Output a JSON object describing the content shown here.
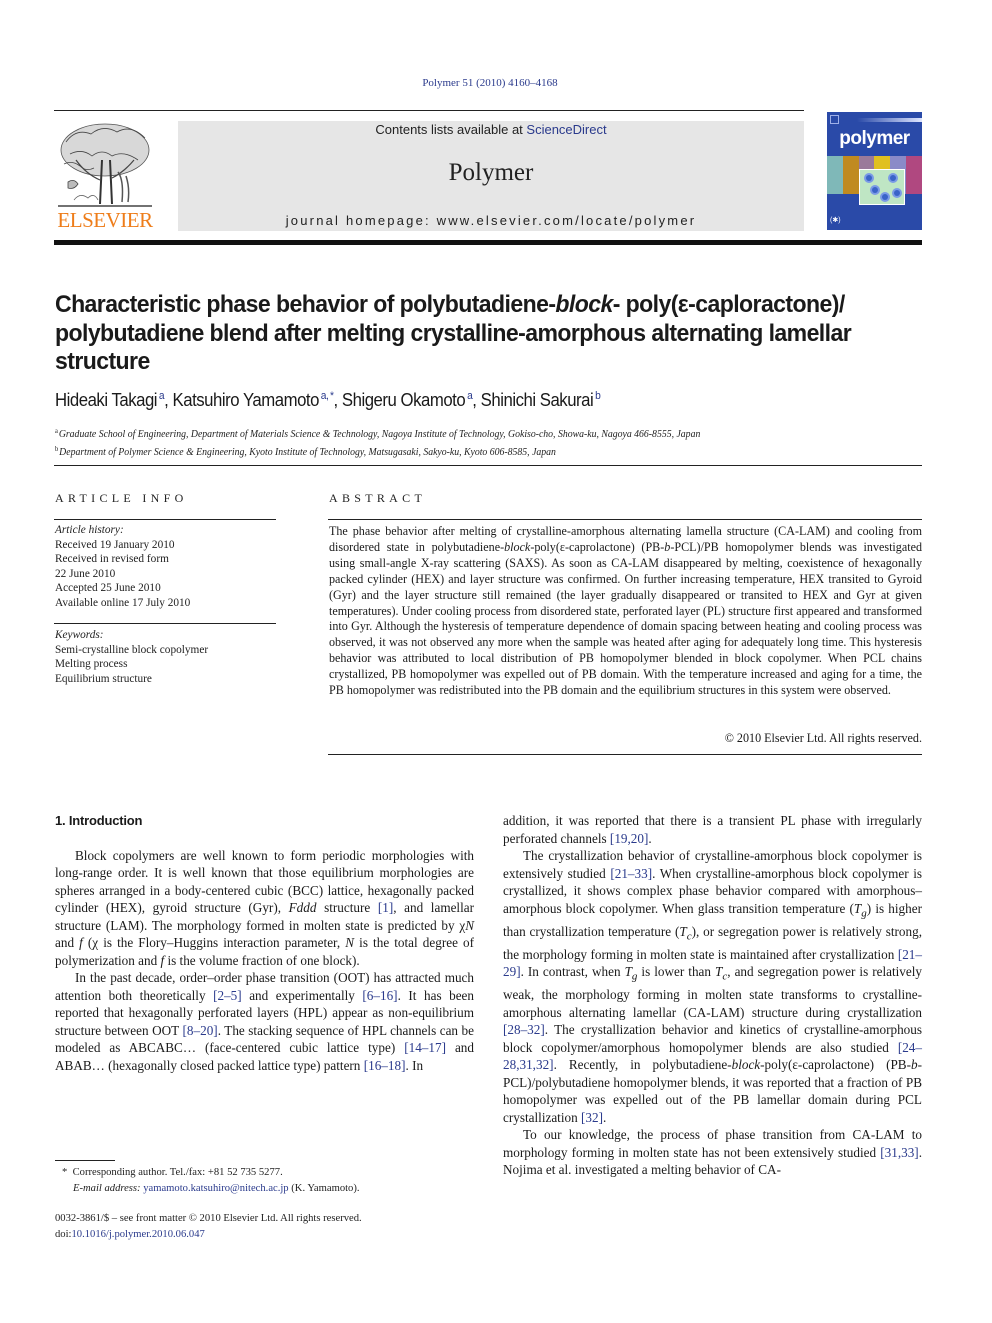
{
  "citation": "Polymer 51 (2010) 4160–4168",
  "publisher": {
    "name": "ELSEVIER",
    "logo_icon": "elsevier-tree-logo",
    "brand_color": "#ee7d1a"
  },
  "masthead": {
    "contents_prefix": "Contents lists available at ",
    "contents_link": "ScienceDirect",
    "journal_name": "Polymer",
    "homepage": "journal homepage: www.elsevier.com/locate/polymer",
    "background_color": "#e6e6e6"
  },
  "cover": {
    "title": "polymer",
    "background_color": "#2a4aa8"
  },
  "link_color": "#2a3a8c",
  "article": {
    "title_part1": "Characteristic phase behavior of polybutadiene-",
    "title_italic": "block",
    "title_part2": "- poly(ε-caploractone)/ polybutadiene blend after melting crystalline-amorphous alternating lamellar structure",
    "authors": [
      {
        "name": "Hideaki Takagi",
        "affil": "a"
      },
      {
        "name": "Katsuhiro Yamamoto",
        "affil": "a, *"
      },
      {
        "name": "Shigeru Okamoto",
        "affil": "a"
      },
      {
        "name": "Shinichi Sakurai",
        "affil": "b"
      }
    ],
    "affiliations": [
      {
        "mark": "a",
        "text": "Graduate School of Engineering, Department of Materials Science & Technology, Nagoya Institute of Technology, Gokiso-cho, Showa-ku, Nagoya 466-8555, Japan"
      },
      {
        "mark": "b",
        "text": "Department of Polymer Science & Engineering, Kyoto Institute of Technology, Matsugasaki, Sakyo-ku, Kyoto 606-8585, Japan"
      }
    ]
  },
  "article_info": {
    "heading": "ARTICLE INFO",
    "history_heading": "Article history:",
    "history": [
      "Received 19 January 2010",
      "Received in revised form",
      "22 June 2010",
      "Accepted 25 June 2010",
      "Available online 17 July 2010"
    ],
    "keywords_heading": "Keywords:",
    "keywords": [
      "Semi-crystalline block copolymer",
      "Melting process",
      "Equilibrium structure"
    ]
  },
  "abstract": {
    "heading": "ABSTRACT",
    "text_1": "The phase behavior after melting of crystalline-amorphous alternating lamella structure (CA-LAM) and cooling from disordered state in polybutadiene-",
    "text_italic_1": "block",
    "text_2": "-poly(ε-caprolactone) (PB-",
    "text_italic_2": "b",
    "text_3": "-PCL)/PB homopolymer blends was investigated using small-angle X-ray scattering (SAXS). As soon as CA-LAM disappeared by melting, coexistence of hexagonally packed cylinder (HEX) and layer structure was confirmed. On further increasing temperature, HEX transited to Gyroid (Gyr) and the layer structure still remained (the layer gradually disappeared or transited to HEX and Gyr at given temperatures). Under cooling process from disordered state, perforated layer (PL) structure first appeared and transformed into Gyr. Although the hysteresis of temperature dependence of domain spacing between heating and cooling process was observed, it was not observed any more when the sample was heated after aging for adequately long time. This hysteresis behavior was attributed to local distribution of PB homopolymer blended in block copolymer. When PCL chains crystallized, PB homopolymer was expelled out of PB domain. With the temperature increased and aging for a time, the PB homopolymer was redistributed into the PB domain and the equilibrium structures in this system were observed.",
    "copyright": "© 2010 Elsevier Ltd. All rights reserved."
  },
  "body": {
    "section_heading": "1.  Introduction",
    "left": {
      "p1_a": "Block copolymers are well known to form periodic morphologies with long-range order. It is well known that those equilibrium morphologies are spheres arranged in a body-centered cubic (BCC) lattice, hexagonally packed cylinder (HEX), gyroid structure (Gyr), ",
      "p1_fddd": "Fddd",
      "p1_b": " structure ",
      "p1_ref1": "[1]",
      "p1_c": ", and lamellar structure (LAM). The morphology formed in molten state is predicted by χ",
      "p1_N": "N",
      "p1_d": " and ",
      "p1_f": "f",
      "p1_e": " (χ is the Flory–Huggins interaction parameter, ",
      "p1_N2": "N",
      "p1_g": " is the total degree of polymerization and ",
      "p1_f2": "f",
      "p1_h": " is the volume fraction of one block).",
      "p2_a": "In the past decade, order–order phase transition (OOT) has attracted much attention both theoretically ",
      "p2_ref1": "[2–5]",
      "p2_b": " and experimentally ",
      "p2_ref2": "[6–16]",
      "p2_c": ". It has been reported that hexagonally perforated layers (HPL) appear as non-equilibrium structure between OOT ",
      "p2_ref3": "[8–20]",
      "p2_d": ". The stacking sequence of HPL channels can be modeled as ABCABC… (face-centered cubic lattice type) ",
      "p2_ref4": "[14–17]",
      "p2_e": " and ABAB… (hexagonally closed packed lattice type) pattern ",
      "p2_ref5": "[16–18]",
      "p2_f": ". In"
    },
    "right": {
      "p1_a": "addition, it was reported that there is a transient PL phase with irregularly perforated channels ",
      "p1_ref1": "[19,20]",
      "p1_b": ".",
      "p2_a": "The crystallization behavior of crystalline-amorphous block copolymer is extensively studied ",
      "p2_ref1": "[21–33]",
      "p2_b": ". When crystalline-amorphous block copolymer is crystallized, it shows complex phase behavior compared with amorphous–amorphous block copolymer. When glass transition temperature (",
      "p2_Tg": "T",
      "p2_g": "g",
      "p2_c": ") is higher than crystallization temperature (",
      "p2_Tc": "T",
      "p2_csub": "c",
      "p2_d": "), or segregation power is relatively strong, the morphology forming in molten state is maintained after crystallization ",
      "p2_ref2": "[21–29]",
      "p2_e": ". In contrast, when ",
      "p2_Tg2": "T",
      "p2_g2": "g",
      "p2_f": " is lower than ",
      "p2_Tc2": "T",
      "p2_csub2": "c",
      "p2_h": ", and segregation power is relatively weak, the morphology forming in molten state transforms to crystalline-amorphous alternating lamellar (CA-LAM) structure during crystallization ",
      "p2_ref3": "[28–32]",
      "p2_i": ". The crystallization behavior and kinetics of crystalline-amorphous block copolymer/amorphous homopolymer blends are also studied ",
      "p2_ref4": "[24–28,31,32]",
      "p2_j": ". Recently, in polybutadiene-",
      "p2_block": "block",
      "p2_k": "-poly(ε-caprolactone) (PB-",
      "p2_b_it": "b",
      "p2_l": "-PCL)/polybutadiene homopolymer blends, it was reported that a fraction of PB homopolymer was expelled out of the PB lamellar domain during PCL crystallization ",
      "p2_ref5": "[32]",
      "p2_m": ".",
      "p3_a": "To our knowledge, the process of phase transition from CA-LAM to morphology forming in molten state has not been extensively studied ",
      "p3_ref1": "[31,33]",
      "p3_b": ". Nojima et al. investigated a melting behavior of CA-"
    }
  },
  "footnote": {
    "star": "*",
    "corresponding": "Corresponding author. Tel./fax: +81 52 735 5277.",
    "email_label": "E-mail address:",
    "email": "yamamoto.katsuhiro@nitech.ac.jp",
    "email_suffix": "(K. Yamamoto)."
  },
  "frontmatter": {
    "issn_line": "0032-3861/$ – see front matter © 2010 Elsevier Ltd. All rights reserved.",
    "doi_prefix": "doi:",
    "doi": "10.1016/j.polymer.2010.06.047"
  }
}
